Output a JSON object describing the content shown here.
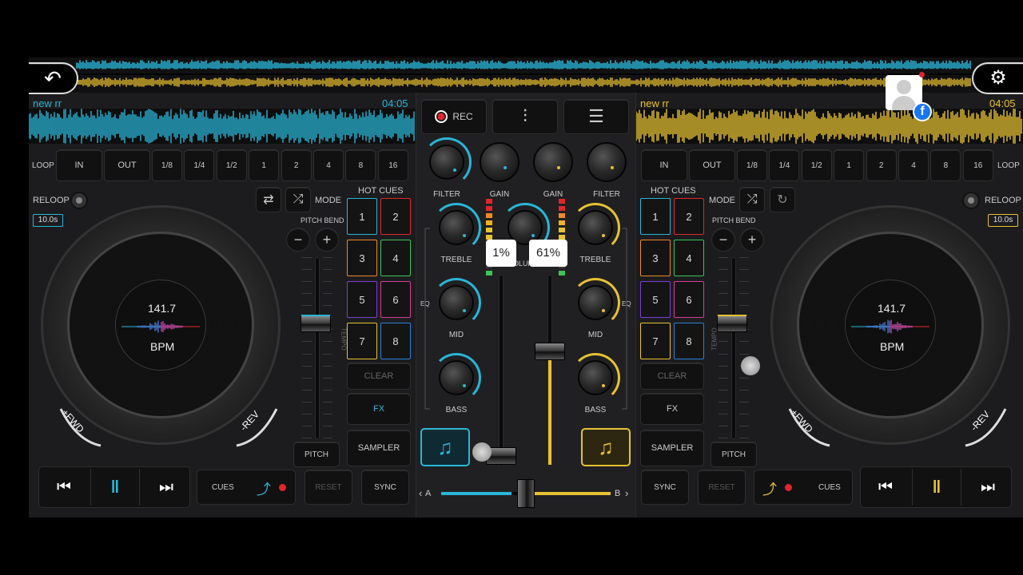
{
  "colors": {
    "deckA": "#29b6d8",
    "deckB": "#e7c232",
    "rec": "#e0262b",
    "bg": "#1c1c1e"
  },
  "icons": {
    "back": "back-arrow-icon",
    "settings": "gear-icon",
    "avatar": "user-avatar-icon",
    "facebook": "facebook-icon"
  },
  "deckA": {
    "track_name": "new rr",
    "time": "04:05",
    "loop_label": "LOOP",
    "in": "IN",
    "out": "OUT",
    "loop_sizes": [
      "1/8",
      "1/4",
      "1/2",
      "1",
      "2",
      "4",
      "8",
      "16"
    ],
    "reloop": "RELOOP",
    "reloop_time": "10.0s",
    "mode": "MODE",
    "pitch_bend": "PITCH BEND",
    "minus": "−",
    "plus": "+",
    "tempo": "TEMPO",
    "bpm_value": "141.7",
    "bpm_label": "BPM",
    "fwd": "+FWD",
    "rev": "-REV",
    "hot_cues_title": "HOT CUES",
    "cues": [
      "1",
      "2",
      "3",
      "4",
      "5",
      "6",
      "7",
      "8"
    ],
    "clear": "CLEAR",
    "fx": "FX",
    "sampler": "SAMPLER",
    "pitch": "PITCH",
    "cues_btn": "CUES",
    "reset": "RESET",
    "sync": "SYNC",
    "tempo_level": 0.35
  },
  "deckB": {
    "track_name": "new rr",
    "time": "04:05",
    "loop_label": "LOOP",
    "in": "IN",
    "out": "OUT",
    "loop_sizes": [
      "1/8",
      "1/4",
      "1/2",
      "1",
      "2",
      "4",
      "8",
      "16"
    ],
    "reloop": "RELOOP",
    "reloop_time": "10.0s",
    "mode": "MODE",
    "pitch_bend": "PITCH BEND",
    "minus": "−",
    "plus": "+",
    "tempo": "TEMPO",
    "bpm_value": "141.7",
    "bpm_label": "BPM",
    "fwd": "+FWD",
    "rev": "-REV",
    "hot_cues_title": "HOT CUES",
    "cues": [
      "1",
      "2",
      "3",
      "4",
      "5",
      "6",
      "7",
      "8"
    ],
    "clear": "CLEAR",
    "fx": "FX",
    "sampler": "SAMPLER",
    "pitch": "PITCH",
    "cues_btn": "CUES",
    "reset": "RESET",
    "sync": "SYNC",
    "tempo_level": 0.35
  },
  "mixer": {
    "rec": "REC",
    "filter": "FILTER",
    "gain": "GAIN",
    "treble": "TREBLE",
    "mid": "MID",
    "bass": "BASS",
    "eq": "EQ",
    "volume": "VOLUME",
    "volA_label": "1%",
    "volB_label": "61%",
    "volA_level": 0.01,
    "volB_level": 0.61,
    "cross_a": "A",
    "cross_b": "B",
    "crossfader_position": 0.5
  }
}
